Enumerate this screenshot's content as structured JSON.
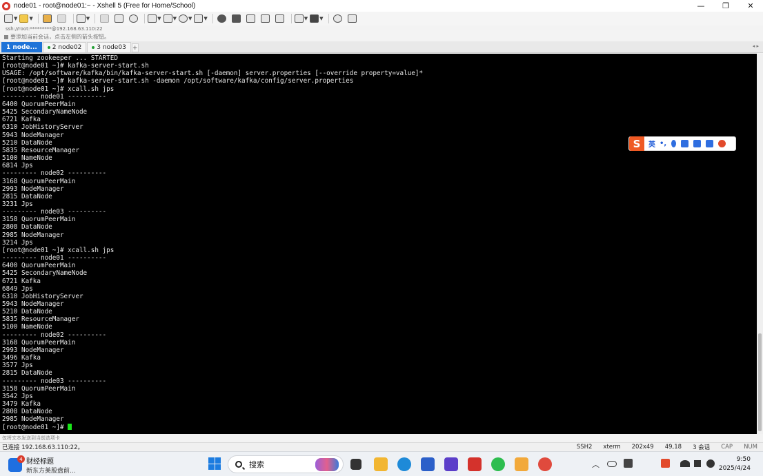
{
  "window": {
    "title": "node01 - root@node01:~ - Xshell 5 (Free for Home/School)",
    "controls": {
      "minimize": "—",
      "restore": "❐",
      "close": "✕"
    }
  },
  "address": "ssh://root:*********@192.168.63.110:22",
  "hint": "要添加当前会话，点击左侧的箭头按钮。",
  "tabs": [
    {
      "label": "1 node...",
      "active": true
    },
    {
      "label": "2 node02",
      "active": false
    },
    {
      "label": "3 node03",
      "active": false
    }
  ],
  "tab_add": "+",
  "terminal": {
    "lines": [
      "Starting zookeeper ... STARTED",
      "[root@node01 ~]# kafka-server-start.sh",
      "USAGE: /opt/software/kafka/bin/kafka-server-start.sh [-daemon] server.properties [--override property=value]*",
      "[root@node01 ~]# kafka-server-start.sh -daemon /opt/software/kafka/config/server.properties",
      "[root@node01 ~]# xcall.sh jps",
      "--------- node01 ----------",
      "6400 QuorumPeerMain",
      "5425 SecondaryNameNode",
      "6721 Kafka",
      "6310 JobHistoryServer",
      "5943 NodeManager",
      "5210 DataNode",
      "5835 ResourceManager",
      "5100 NameNode",
      "6814 Jps",
      "--------- node02 ----------",
      "3168 QuorumPeerMain",
      "2993 NodeManager",
      "2815 DataNode",
      "3231 Jps",
      "--------- node03 ----------",
      "3158 QuorumPeerMain",
      "2808 DataNode",
      "2985 NodeManager",
      "3214 Jps",
      "[root@node01 ~]# xcall.sh jps",
      "--------- node01 ----------",
      "6400 QuorumPeerMain",
      "5425 SecondaryNameNode",
      "6721 Kafka",
      "6849 Jps",
      "6310 JobHistoryServer",
      "5943 NodeManager",
      "5210 DataNode",
      "5835 ResourceManager",
      "5100 NameNode",
      "--------- node02 ----------",
      "3168 QuorumPeerMain",
      "2993 NodeManager",
      "3496 Kafka",
      "3577 Jps",
      "2815 DataNode",
      "--------- node03 ----------",
      "3158 QuorumPeerMain",
      "3542 Jps",
      "3479 Kafka",
      "2808 DataNode",
      "2985 NodeManager"
    ],
    "prompt": "[root@node01 ~]# ",
    "cursor_color": "#19e619"
  },
  "ime": {
    "logo": "S",
    "lang": "英",
    "punct": "•,",
    "icons": [
      "mic-icon",
      "keyboard-icon",
      "skin-icon",
      "toolbox-icon",
      "avatar-icon"
    ]
  },
  "send_hint": "仅将文本发送到当前选项卡",
  "status": {
    "connection": "已连接 192.168.63.110:22。",
    "protocol": "SSH2",
    "term": "xterm",
    "size": "202x49",
    "cursor_pos": "49,18",
    "sessions": "3 会话",
    "caps": "CAP",
    "num": "NUM"
  },
  "taskbar": {
    "weather_badge": "4",
    "weather_title": "财经标题",
    "weather_sub": "新东方美股盘前...",
    "search_placeholder": "搜索",
    "time": "9:50",
    "date": "2025/4/24"
  }
}
